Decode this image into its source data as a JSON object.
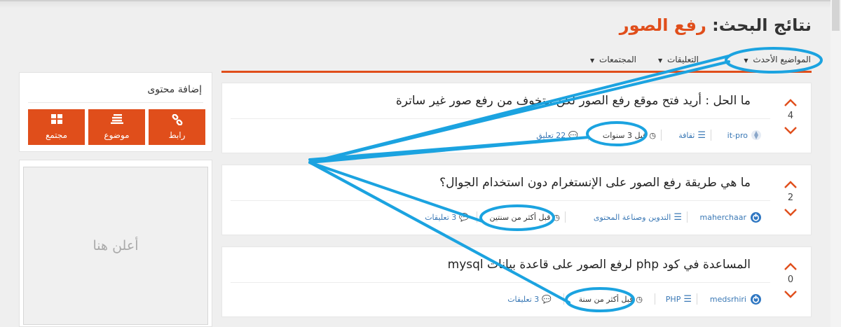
{
  "page": {
    "title_prefix": "نتائج البحث:",
    "query": "رفع الصور"
  },
  "tabs": [
    {
      "label": "المواضيع الأحدث"
    },
    {
      "label": "التعليقات"
    },
    {
      "label": "المجتمعات"
    }
  ],
  "sidebar": {
    "add_title": "إضافة محتوى",
    "buttons": [
      {
        "label": "رابط",
        "icon": "link-icon"
      },
      {
        "label": "موضوع",
        "icon": "lines-icon"
      },
      {
        "label": "مجتمع",
        "icon": "grid-icon"
      }
    ],
    "ad_text": "أعلن هنا"
  },
  "posts": [
    {
      "title": "ما الحل : أريد فتح موقع رفع الصور لكن متخوف من رفع صور غير ساترة",
      "votes": "4",
      "author": "it-pro",
      "category": "ثقافة",
      "time": "قبل 3 سنوات",
      "comments": "22 تعليق"
    },
    {
      "title": "ما هي طريقة رفع الصور على الإنستغرام دون استخدام الجوال؟",
      "votes": "2",
      "author": "maherchaar",
      "category": "التدوين وصناعة المحتوى",
      "time": "قبل أكثر من سنتين",
      "comments": "3 تعليقات"
    },
    {
      "title": "المساعدة في كود php لرفع الصور على قاعدة بيانات mysql",
      "votes": "0",
      "author": "medsrhiri",
      "category": "PHP",
      "time": "قبل أكثر من سنة",
      "comments": "3 تعليقات"
    }
  ],
  "colors": {
    "accent": "#e04e1b",
    "link": "#3a78b5",
    "annotation": "#1ba3e0"
  }
}
